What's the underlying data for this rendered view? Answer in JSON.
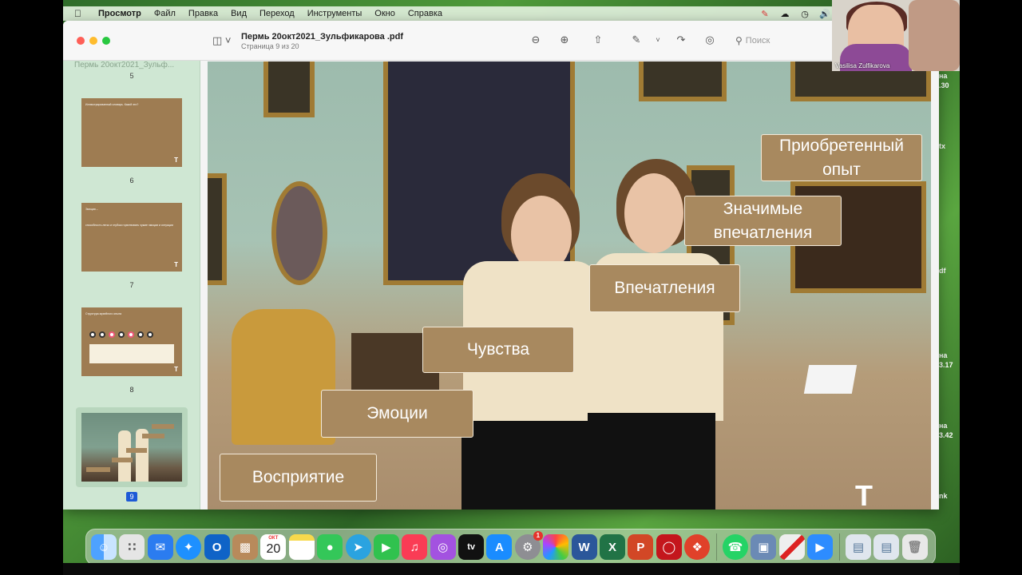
{
  "menubar": {
    "apple_icon": "apple-icon",
    "app_name": "Просмотр",
    "items": [
      "Файл",
      "Правка",
      "Вид",
      "Переход",
      "Инструменты",
      "Окно",
      "Справка"
    ],
    "status_icons": [
      "pen-tablet-icon",
      "cloud-icon",
      "time-machine-icon",
      "volume-icon",
      "bluetooth-icon",
      "us-flag-icon",
      "battery-icon",
      "wifi-icon",
      "user-icon",
      "spotlight-icon"
    ]
  },
  "window": {
    "doc_title": "Пермь 20окт2021_Зульфикарова .pdf",
    "page_info": "Страница 9 из 20",
    "search_placeholder": "Поиск",
    "toolbar_icons": [
      "sidebar-toggle-icon",
      "zoom-out-icon",
      "zoom-in-icon",
      "share-icon",
      "markup-pen-icon",
      "chevron-down-icon",
      "rotate-icon",
      "markup-toolbar-icon",
      "search-icon"
    ]
  },
  "sidebar": {
    "title": "Пермь 20окт2021_Зульф...",
    "pages": [
      {
        "num": "5"
      },
      {
        "num": "6",
        "heading": "Иллюстрированный словарь. Какой это?"
      },
      {
        "num": "7",
        "heading": "Эмоция –",
        "body": "способность легко и глубоко чувствовать чужие эмоции и ситуации"
      },
      {
        "num": "8",
        "heading": "Структура музейного опыта"
      },
      {
        "num": "9",
        "selected": true
      }
    ]
  },
  "slide": {
    "labels": {
      "acquired": "Приобретенный опыт",
      "significant": "Значимые впечатления",
      "impressions": "Впечатления",
      "feelings": "Чувства",
      "emotions": "Эмоции",
      "perception": "Восприятие"
    },
    "logo_glyph": "Т"
  },
  "side_notes": [
    "на",
    ".30",
    "tx",
    "df",
    "на",
    "3.17",
    "на",
    "3.42",
    "nk"
  ],
  "video": {
    "participant_name": "Vasilisa Zulfikarova"
  },
  "dock": {
    "calendar_month": "ОКТ",
    "calendar_day": "20",
    "system_prefs_badge": "1",
    "apps": [
      "finder",
      "launchpad",
      "mail",
      "safari",
      "outlook",
      "notes-brown",
      "calendar",
      "notes",
      "messages",
      "telegram",
      "facetime",
      "music",
      "podcasts",
      "apple-tv",
      "app-store",
      "system-preferences",
      "photos",
      "word",
      "excel",
      "powerpoint",
      "security",
      "yandex",
      "whatsapp",
      "preview",
      "tool",
      "zoom",
      "downloads-a",
      "downloads-b",
      "trash"
    ]
  },
  "colors": {
    "label_bg": "#a8895f",
    "menubar_bg": "#e1f0dc",
    "sidebar_bg": "#cfe7d3",
    "selection": "#1d5ad6"
  }
}
